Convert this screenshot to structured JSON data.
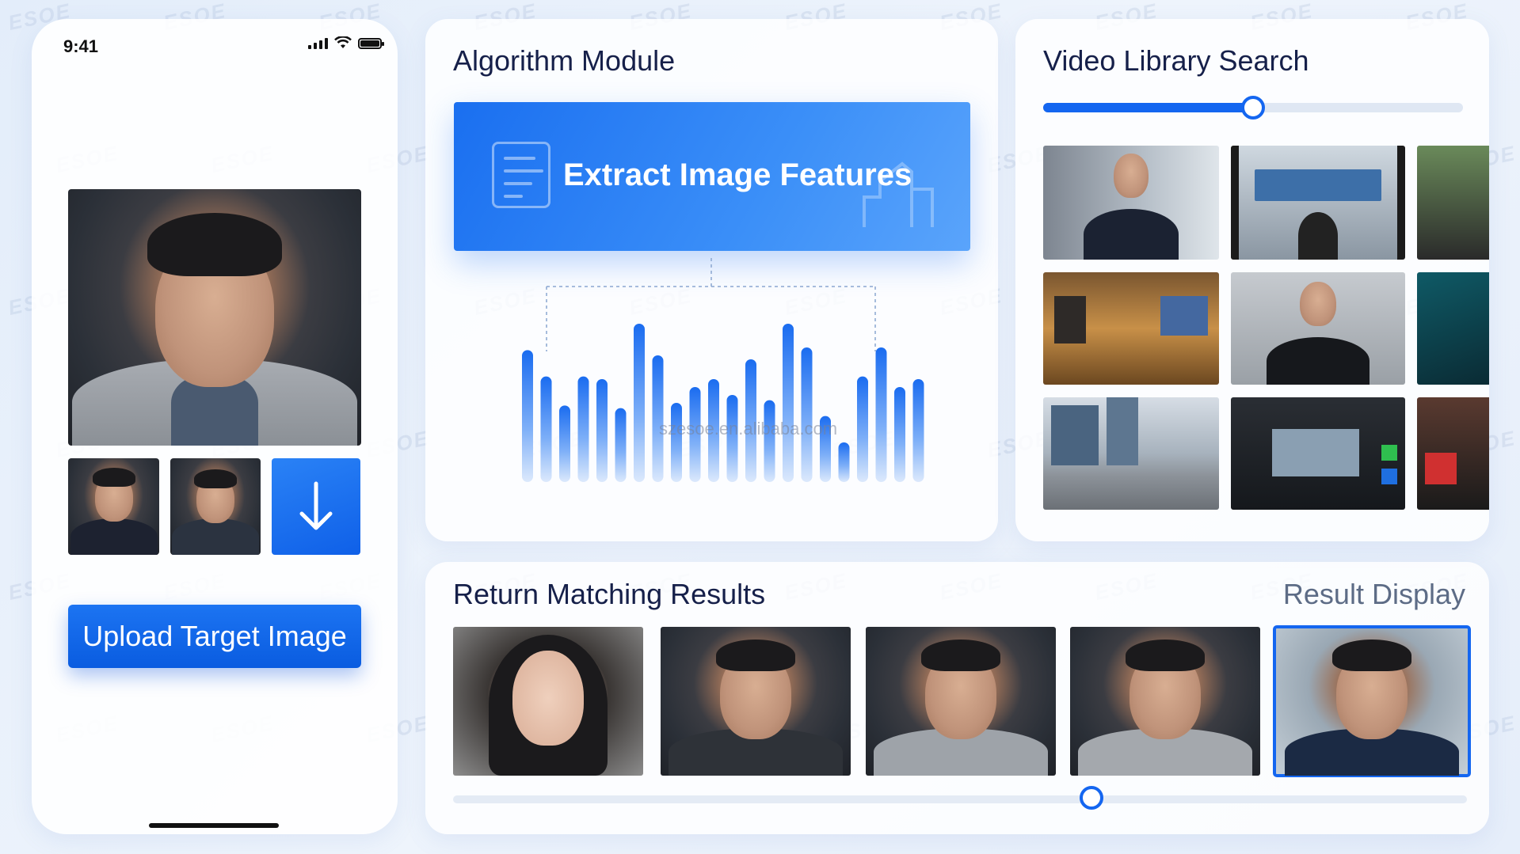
{
  "phone": {
    "status_time": "9:41",
    "upload_button_label": "Upload Target Image"
  },
  "algorithm": {
    "title": "Algorithm Module",
    "extract_label": "Extract Image Features",
    "watermark": "szesoe.en.alibaba.com"
  },
  "chart_data": {
    "type": "bar",
    "values": [
      100,
      80,
      58,
      80,
      78,
      56,
      120,
      96,
      60,
      72,
      78,
      66,
      93,
      62,
      120,
      102,
      50,
      30,
      80,
      102,
      72,
      78
    ]
  },
  "video_library": {
    "title": "Video Library Search",
    "search_progress": 0.5
  },
  "results": {
    "title": "Return Matching Results",
    "display_label": "Result Display",
    "scroll_position": 0.63
  },
  "brand_watermark": "ESOE",
  "colors": {
    "accent": "#1466f0",
    "title_text": "#16204a",
    "muted_text": "#5d6c86"
  }
}
